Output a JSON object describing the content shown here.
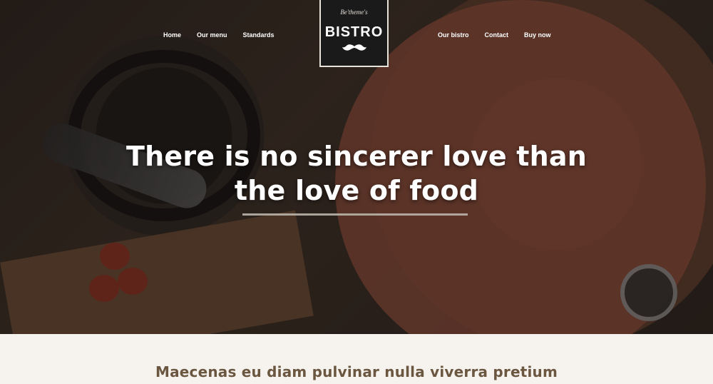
{
  "nav": {
    "left": [
      "Home",
      "Our menu",
      "Standards"
    ],
    "right": [
      "Our bistro",
      "Contact",
      "Buy now"
    ]
  },
  "logo": {
    "top_text": "Be'theme's",
    "main_text": "BISTRO",
    "icon": "mustache-icon"
  },
  "hero": {
    "headline_line1": "There is no sincerer love than",
    "headline_line2": "the love of food"
  },
  "content": {
    "heading": "Maecenas eu diam pulvinar nulla viverra pretium"
  },
  "colors": {
    "heading_text": "#6b5640",
    "logo_bg": "#1a1a1a",
    "logo_border": "#e7e2da",
    "page_bg": "#f6f3ef"
  }
}
